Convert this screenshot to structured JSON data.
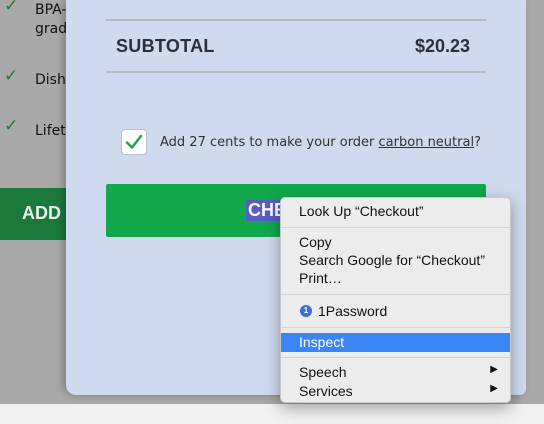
{
  "background": {
    "features": [
      {
        "line1": "BPA-",
        "line2": "grad"
      },
      {
        "line1": "Dishw"
      },
      {
        "line1": "Lifet"
      }
    ],
    "add_button_label": "ADD"
  },
  "cart": {
    "subtotal_label": "SUBTOTAL",
    "subtotal_value": "$20.23",
    "carbon_checkbox_checked": true,
    "carbon_text_before": "Add 27 cents to make your order ",
    "carbon_link": "carbon neutral",
    "carbon_text_after": "?",
    "checkout_label_visible": "CHE"
  },
  "context_menu": {
    "items": [
      {
        "label": "Look Up “Checkout”"
      },
      {
        "label": "Copy"
      },
      {
        "label": "Search Google for “Checkout”"
      },
      {
        "label": "Print…"
      },
      {
        "label": "1Password"
      },
      {
        "label": "Inspect",
        "highlighted": true
      },
      {
        "label": "Speech",
        "submenu": true
      },
      {
        "label": "Services",
        "submenu": true
      }
    ],
    "submenu_arrow": "▶"
  },
  "colors": {
    "panel_bg": "#cfdaee",
    "checkout_green": "#12a84c",
    "menu_highlight": "#3b86f7",
    "text_selection": "#5a5bc8"
  }
}
